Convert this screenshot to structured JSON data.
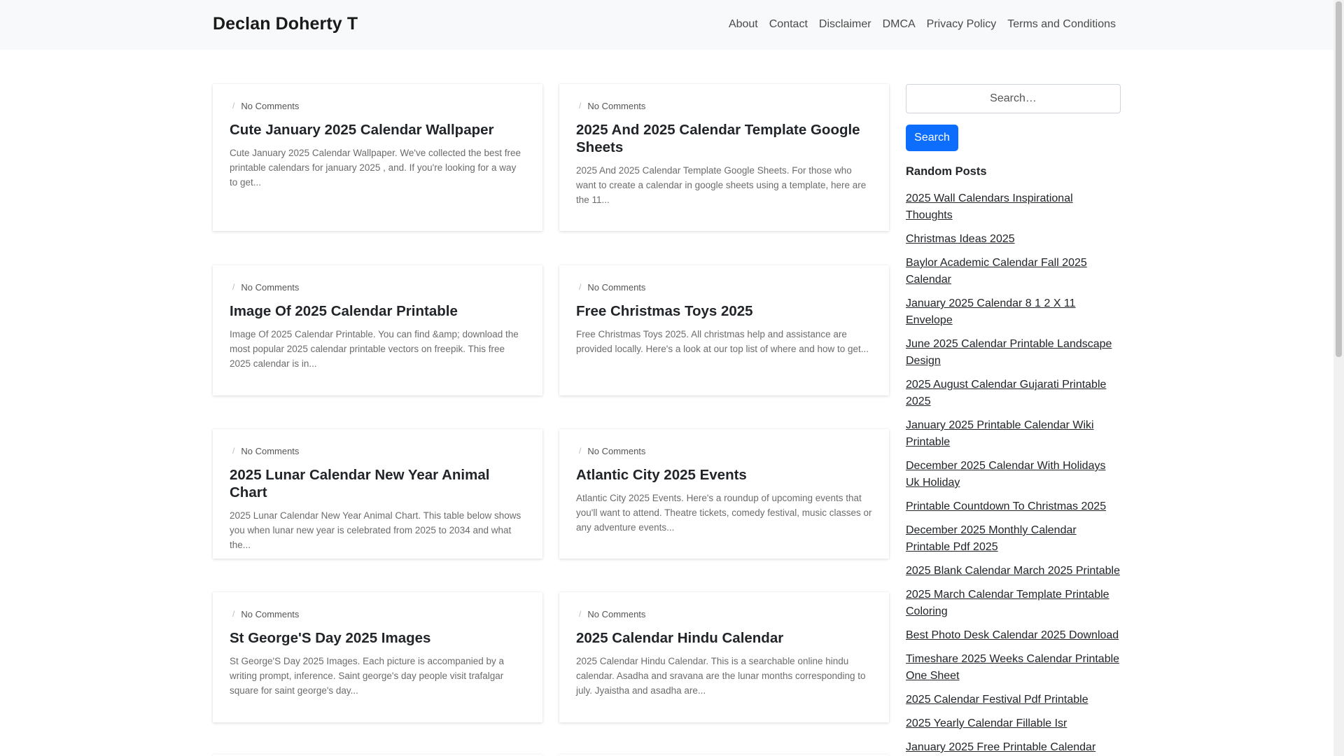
{
  "site": {
    "brand": "Declan Doherty T"
  },
  "nav": [
    "About",
    "Contact",
    "Disclaimer",
    "DMCA",
    "Privacy Policy",
    "Terms and Conditions"
  ],
  "posts": [
    {
      "comments": "No Comments",
      "title": "Cute January 2025 Calendar Wallpaper",
      "excerpt": "Cute January 2025 Calendar Wallpaper. We've collected the best free printable calendars for january 2025 , and. If you're looking for a way to get..."
    },
    {
      "comments": "No Comments",
      "title": "2025 And 2025 Calendar Template Google Sheets",
      "excerpt": "2025 And 2025 Calendar Template Google Sheets. For those who want to create a calendar in google sheets using a template, here are the 11..."
    },
    {
      "comments": "No Comments",
      "title": "Image Of 2025 Calendar Printable",
      "excerpt": "Image Of 2025 Calendar Printable. You can find &amp; download the most popular 2025 calendar printable vectors on freepik. This free 2025 calendar is in..."
    },
    {
      "comments": "No Comments",
      "title": "Free Christmas Toys 2025",
      "excerpt": "Free Christmas Toys 2025. All christmas help and assistance are provided locally. Here's a look at our top list of where and how to get..."
    },
    {
      "comments": "No Comments",
      "title": "2025 Lunar Calendar New Year Animal Chart",
      "excerpt": "2025 Lunar Calendar New Year Animal Chart. This table below shows you when lunar new year is celebrated from 2025 to 2034 and what the..."
    },
    {
      "comments": "No Comments",
      "title": "Atlantic City 2025 Events",
      "excerpt": "Atlantic City 2025 Events. Here's a roundup of upcoming events that you'll want to attend. Theatre tickets, comedy festival, music classes or any adventure events..."
    },
    {
      "comments": "No Comments",
      "title": "St George'S Day 2025 Images",
      "excerpt": "St George'S Day 2025 Images. Each picture is accompanied by a writing prompt, inference. Saint george's day people visit trafalgar square for saint george's day..."
    },
    {
      "comments": "No Comments",
      "title": "2025 Calendar Hindu Calendar",
      "excerpt": "2025 Calendar Hindu Calendar. This is a searchable online hindu calendar. Asadha and sravana are the lunar months corresponding to july. Jyaistha and asadha are..."
    }
  ],
  "sidebar": {
    "search_placeholder": "Search…",
    "search_button": "Search",
    "random_heading": "Random Posts",
    "random_posts": [
      "2025 Wall Calendars Inspirational Thoughts",
      "Christmas Ideas 2025",
      "Baylor Academic Calendar Fall 2025 Calendar",
      "January 2025 Calendar 8 1 2 X 11 Envelope",
      "June 2025 Calendar Printable Landscape Design",
      "2025 August Calendar Gujarati Printable 2025",
      "January 2025 Printable Calendar Wiki Printable",
      "December 2025 Calendar With Holidays Uk Holiday",
      "Printable Countdown To Christmas 2025",
      "December 2025 Monthly Calendar Printable Pdf 2025",
      "2025 Blank Calendar March 2025 Printable",
      "2025 March Calendar Template Printable Coloring",
      "Best Photo Desk Calendar 2025 Download",
      "Timeshare 2025 Weeks Calendar Printable One Sheet",
      "2025 Calendar Festival Pdf Printable",
      "2025 Yearly Calendar Fillable Isr",
      "January 2025 Free Printable Calendar"
    ]
  }
}
